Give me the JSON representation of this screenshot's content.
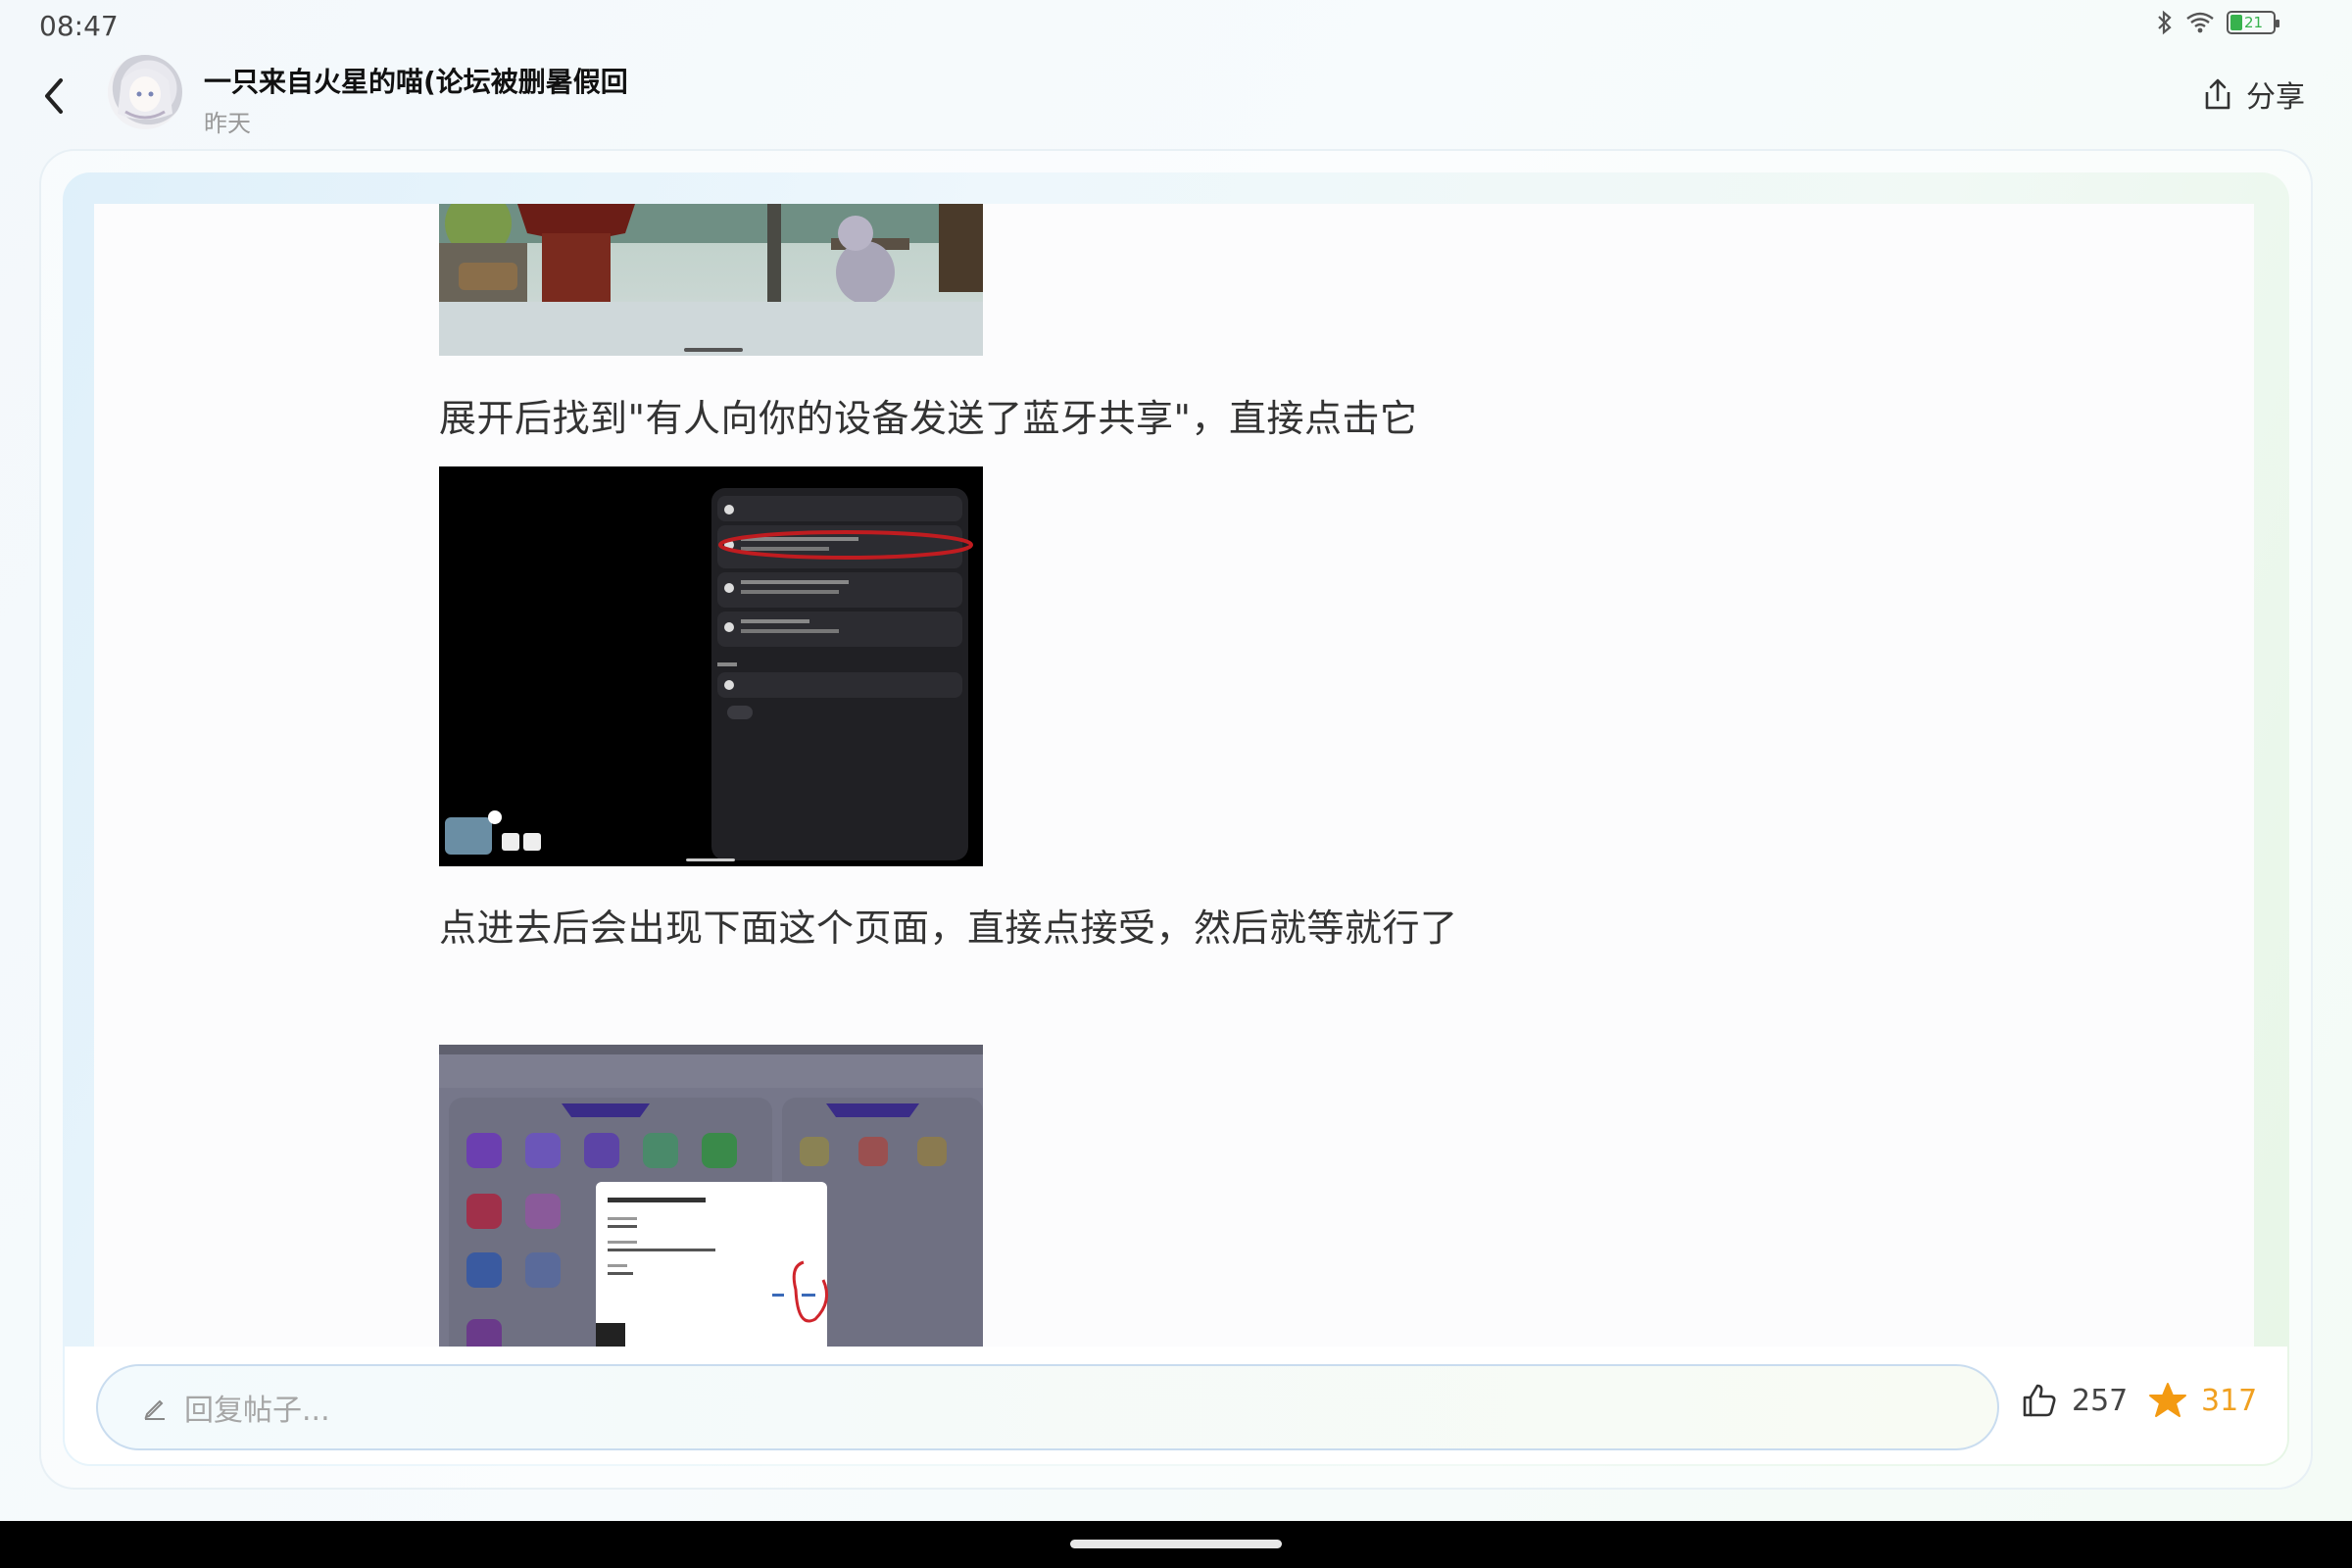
{
  "status_bar": {
    "time": "08:47",
    "battery_level": "21",
    "icons": [
      "bluetooth-icon",
      "wifi-icon",
      "battery-icon"
    ]
  },
  "header": {
    "author_name": "一只来自火星的喵(论坛被删暑假回",
    "date": "昨天",
    "share_label": "分享"
  },
  "post": {
    "paragraphs": [
      "展开后找到\"有人向你的设备发送了蓝牙共享\"，直接点击它",
      "点进去后会出现下面这个页面，直接点接受，然后就等就行了"
    ],
    "images": [
      {
        "description_name": "game-screenshot-partial"
      },
      {
        "description_name": "notification-shade-screenshot"
      },
      {
        "description_name": "accept-file-dialog-screenshot"
      }
    ]
  },
  "footer": {
    "reply_placeholder": "回复帖子...",
    "like_count": "257",
    "favorite_count": "317"
  },
  "colors": {
    "accent_orange": "#f0a020",
    "input_border": "#c9dcef",
    "battery_green": "#37b24d"
  }
}
